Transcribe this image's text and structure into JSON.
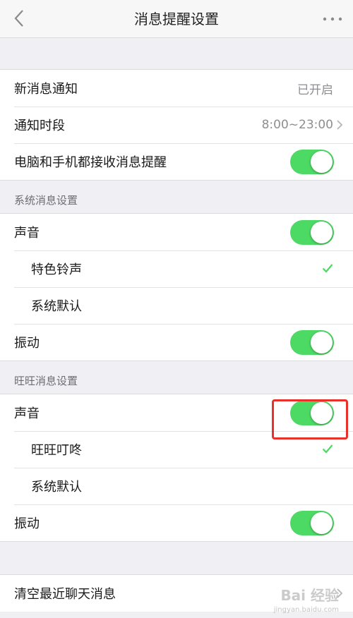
{
  "navbar": {
    "title": "消息提醒设置"
  },
  "general": {
    "new_message_label": "新消息通知",
    "new_message_value": "已开启",
    "period_label": "通知时段",
    "period_value": "8:00~23:00",
    "pc_mobile_label": "电脑和手机都接收消息提醒"
  },
  "system": {
    "title": "系统消息设置",
    "sound_label": "声音",
    "ringtone_special": "特色铃声",
    "ringtone_default": "系统默认",
    "vibrate_label": "振动"
  },
  "wangwang": {
    "title": "旺旺消息设置",
    "sound_label": "声音",
    "ringtone_special": "旺旺叮咚",
    "ringtone_default": "系统默认",
    "vibrate_label": "振动"
  },
  "clear": {
    "label": "清空最近聊天消息"
  },
  "watermark": {
    "brand": "Bai 经验",
    "url": "jingyan.baidu.com"
  },
  "colors": {
    "toggle_on": "#4cd964",
    "check": "#4cd964",
    "highlight": "#e8312a"
  },
  "toggles": {
    "pc_mobile": true,
    "system_sound": true,
    "system_vibrate": true,
    "wangwang_sound": true,
    "wangwang_vibrate": true
  }
}
